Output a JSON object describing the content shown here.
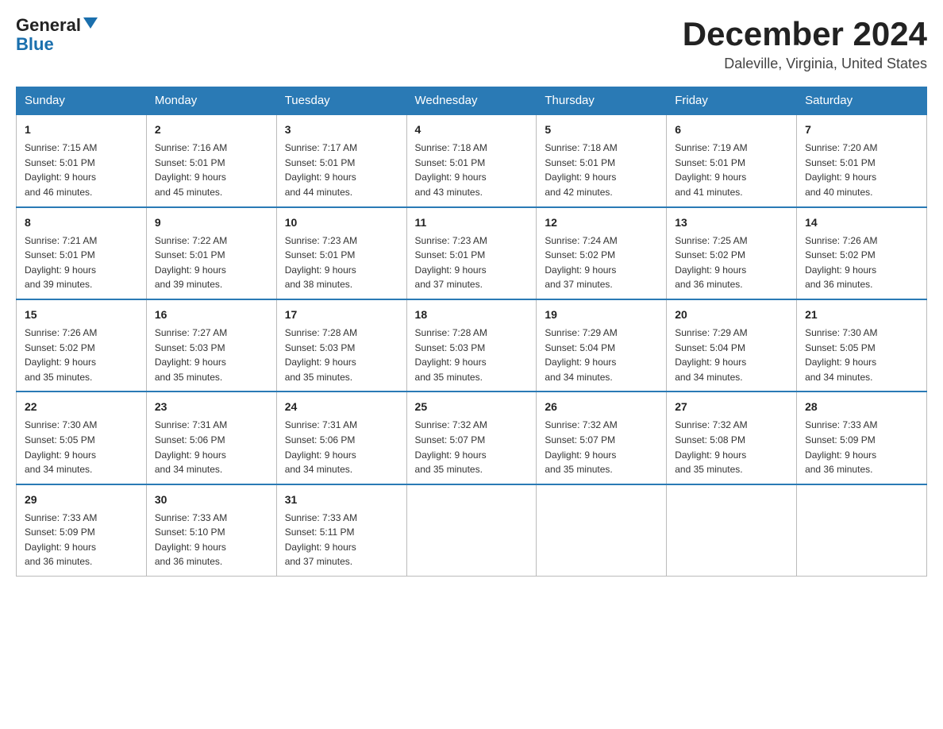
{
  "header": {
    "logo_general": "General",
    "logo_blue": "Blue",
    "month_title": "December 2024",
    "location": "Daleville, Virginia, United States"
  },
  "weekdays": [
    "Sunday",
    "Monday",
    "Tuesday",
    "Wednesday",
    "Thursday",
    "Friday",
    "Saturday"
  ],
  "weeks": [
    [
      {
        "day": "1",
        "sunrise": "Sunrise: 7:15 AM",
        "sunset": "Sunset: 5:01 PM",
        "daylight": "Daylight: 9 hours",
        "minutes": "and 46 minutes."
      },
      {
        "day": "2",
        "sunrise": "Sunrise: 7:16 AM",
        "sunset": "Sunset: 5:01 PM",
        "daylight": "Daylight: 9 hours",
        "minutes": "and 45 minutes."
      },
      {
        "day": "3",
        "sunrise": "Sunrise: 7:17 AM",
        "sunset": "Sunset: 5:01 PM",
        "daylight": "Daylight: 9 hours",
        "minutes": "and 44 minutes."
      },
      {
        "day": "4",
        "sunrise": "Sunrise: 7:18 AM",
        "sunset": "Sunset: 5:01 PM",
        "daylight": "Daylight: 9 hours",
        "minutes": "and 43 minutes."
      },
      {
        "day": "5",
        "sunrise": "Sunrise: 7:18 AM",
        "sunset": "Sunset: 5:01 PM",
        "daylight": "Daylight: 9 hours",
        "minutes": "and 42 minutes."
      },
      {
        "day": "6",
        "sunrise": "Sunrise: 7:19 AM",
        "sunset": "Sunset: 5:01 PM",
        "daylight": "Daylight: 9 hours",
        "minutes": "and 41 minutes."
      },
      {
        "day": "7",
        "sunrise": "Sunrise: 7:20 AM",
        "sunset": "Sunset: 5:01 PM",
        "daylight": "Daylight: 9 hours",
        "minutes": "and 40 minutes."
      }
    ],
    [
      {
        "day": "8",
        "sunrise": "Sunrise: 7:21 AM",
        "sunset": "Sunset: 5:01 PM",
        "daylight": "Daylight: 9 hours",
        "minutes": "and 39 minutes."
      },
      {
        "day": "9",
        "sunrise": "Sunrise: 7:22 AM",
        "sunset": "Sunset: 5:01 PM",
        "daylight": "Daylight: 9 hours",
        "minutes": "and 39 minutes."
      },
      {
        "day": "10",
        "sunrise": "Sunrise: 7:23 AM",
        "sunset": "Sunset: 5:01 PM",
        "daylight": "Daylight: 9 hours",
        "minutes": "and 38 minutes."
      },
      {
        "day": "11",
        "sunrise": "Sunrise: 7:23 AM",
        "sunset": "Sunset: 5:01 PM",
        "daylight": "Daylight: 9 hours",
        "minutes": "and 37 minutes."
      },
      {
        "day": "12",
        "sunrise": "Sunrise: 7:24 AM",
        "sunset": "Sunset: 5:02 PM",
        "daylight": "Daylight: 9 hours",
        "minutes": "and 37 minutes."
      },
      {
        "day": "13",
        "sunrise": "Sunrise: 7:25 AM",
        "sunset": "Sunset: 5:02 PM",
        "daylight": "Daylight: 9 hours",
        "minutes": "and 36 minutes."
      },
      {
        "day": "14",
        "sunrise": "Sunrise: 7:26 AM",
        "sunset": "Sunset: 5:02 PM",
        "daylight": "Daylight: 9 hours",
        "minutes": "and 36 minutes."
      }
    ],
    [
      {
        "day": "15",
        "sunrise": "Sunrise: 7:26 AM",
        "sunset": "Sunset: 5:02 PM",
        "daylight": "Daylight: 9 hours",
        "minutes": "and 35 minutes."
      },
      {
        "day": "16",
        "sunrise": "Sunrise: 7:27 AM",
        "sunset": "Sunset: 5:03 PM",
        "daylight": "Daylight: 9 hours",
        "minutes": "and 35 minutes."
      },
      {
        "day": "17",
        "sunrise": "Sunrise: 7:28 AM",
        "sunset": "Sunset: 5:03 PM",
        "daylight": "Daylight: 9 hours",
        "minutes": "and 35 minutes."
      },
      {
        "day": "18",
        "sunrise": "Sunrise: 7:28 AM",
        "sunset": "Sunset: 5:03 PM",
        "daylight": "Daylight: 9 hours",
        "minutes": "and 35 minutes."
      },
      {
        "day": "19",
        "sunrise": "Sunrise: 7:29 AM",
        "sunset": "Sunset: 5:04 PM",
        "daylight": "Daylight: 9 hours",
        "minutes": "and 34 minutes."
      },
      {
        "day": "20",
        "sunrise": "Sunrise: 7:29 AM",
        "sunset": "Sunset: 5:04 PM",
        "daylight": "Daylight: 9 hours",
        "minutes": "and 34 minutes."
      },
      {
        "day": "21",
        "sunrise": "Sunrise: 7:30 AM",
        "sunset": "Sunset: 5:05 PM",
        "daylight": "Daylight: 9 hours",
        "minutes": "and 34 minutes."
      }
    ],
    [
      {
        "day": "22",
        "sunrise": "Sunrise: 7:30 AM",
        "sunset": "Sunset: 5:05 PM",
        "daylight": "Daylight: 9 hours",
        "minutes": "and 34 minutes."
      },
      {
        "day": "23",
        "sunrise": "Sunrise: 7:31 AM",
        "sunset": "Sunset: 5:06 PM",
        "daylight": "Daylight: 9 hours",
        "minutes": "and 34 minutes."
      },
      {
        "day": "24",
        "sunrise": "Sunrise: 7:31 AM",
        "sunset": "Sunset: 5:06 PM",
        "daylight": "Daylight: 9 hours",
        "minutes": "and 34 minutes."
      },
      {
        "day": "25",
        "sunrise": "Sunrise: 7:32 AM",
        "sunset": "Sunset: 5:07 PM",
        "daylight": "Daylight: 9 hours",
        "minutes": "and 35 minutes."
      },
      {
        "day": "26",
        "sunrise": "Sunrise: 7:32 AM",
        "sunset": "Sunset: 5:07 PM",
        "daylight": "Daylight: 9 hours",
        "minutes": "and 35 minutes."
      },
      {
        "day": "27",
        "sunrise": "Sunrise: 7:32 AM",
        "sunset": "Sunset: 5:08 PM",
        "daylight": "Daylight: 9 hours",
        "minutes": "and 35 minutes."
      },
      {
        "day": "28",
        "sunrise": "Sunrise: 7:33 AM",
        "sunset": "Sunset: 5:09 PM",
        "daylight": "Daylight: 9 hours",
        "minutes": "and 36 minutes."
      }
    ],
    [
      {
        "day": "29",
        "sunrise": "Sunrise: 7:33 AM",
        "sunset": "Sunset: 5:09 PM",
        "daylight": "Daylight: 9 hours",
        "minutes": "and 36 minutes."
      },
      {
        "day": "30",
        "sunrise": "Sunrise: 7:33 AM",
        "sunset": "Sunset: 5:10 PM",
        "daylight": "Daylight: 9 hours",
        "minutes": "and 36 minutes."
      },
      {
        "day": "31",
        "sunrise": "Sunrise: 7:33 AM",
        "sunset": "Sunset: 5:11 PM",
        "daylight": "Daylight: 9 hours",
        "minutes": "and 37 minutes."
      },
      null,
      null,
      null,
      null
    ]
  ]
}
